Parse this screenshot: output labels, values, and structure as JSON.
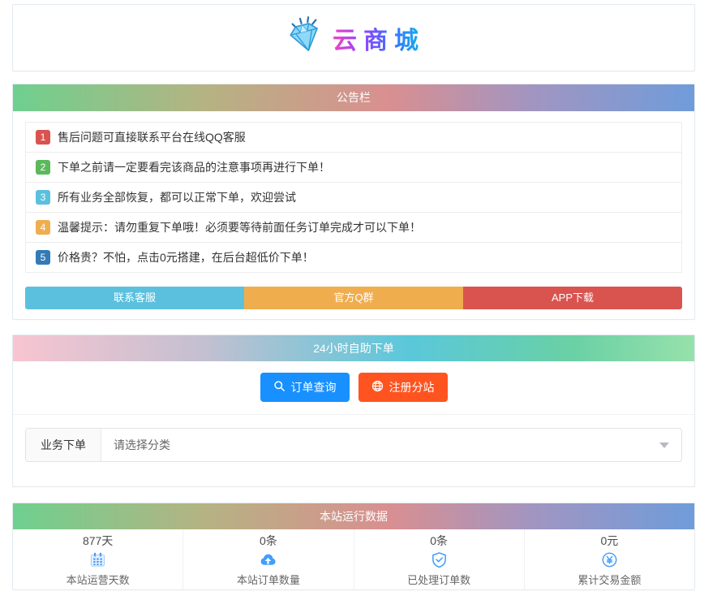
{
  "logo": {
    "title": "云商城",
    "title_gradient": "linear-gradient(90deg, #f542c8 0%, #8a46ff 35%, #2f7bff 70%, #14b8e6 100%)",
    "icon": "diamond-icon"
  },
  "announcement": {
    "header": "公告栏",
    "header_gradient": "linear-gradient(90deg, #6ed08e 0%, #b5b383 28%, #d98f90 55%, #a295c1 76%, #6f9cda 100%)",
    "items": [
      {
        "num": "1",
        "color": "#d9534f",
        "text": "售后问题可直接联系平台在线QQ客服"
      },
      {
        "num": "2",
        "color": "#5cb85c",
        "text": "下单之前请一定要看完该商品的注意事项再进行下单！"
      },
      {
        "num": "3",
        "color": "#5bc0de",
        "text": "所有业务全部恢复，都可以正常下单，欢迎尝试"
      },
      {
        "num": "4",
        "color": "#f0ad4e",
        "text": "温馨提示：请勿重复下单哦！必须要等待前面任务订单完成才可以下单！"
      },
      {
        "num": "5",
        "color": "#337ab7",
        "text": "价格贵？不怕，点击0元搭建，在后台超低价下单！"
      }
    ],
    "buttons": [
      {
        "label": "联系客服",
        "color": "#5bc0de"
      },
      {
        "label": "官方Q群",
        "color": "#f0ad4e"
      },
      {
        "label": "APP下载",
        "color": "#d9534f"
      }
    ]
  },
  "order": {
    "header": "24小时自助下单",
    "header_gradient": "linear-gradient(90deg, #f8c5d1 0%, #c3c0d1 28%, #5ac8da 58%, #6ad0a5 82%, #97e1ab 100%)",
    "query_button": {
      "label": "订单查询",
      "color": "#1890ff",
      "icon": "search-icon"
    },
    "register_button": {
      "label": "注册分站",
      "color": "#ff5420",
      "icon": "globe-icon"
    },
    "form_label": "业务下单",
    "category_placeholder": "请选择分类"
  },
  "stats": {
    "header": "本站运行数据",
    "header_gradient": "linear-gradient(90deg, #6ed08e 0%, #b5b383 28%, #d98f90 55%, #a295c1 76%, #6f9cda 100%)",
    "items": [
      {
        "value": "877天",
        "label": "本站运营天数",
        "icon": "calendar-icon"
      },
      {
        "value": "0条",
        "label": "本站订单数量",
        "icon": "cloud-upload-icon"
      },
      {
        "value": "0条",
        "label": "已处理订单数",
        "icon": "shield-check-icon"
      },
      {
        "value": "0元",
        "label": "累计交易金额",
        "icon": "yen-circle-icon"
      }
    ]
  },
  "colors": {
    "card_border": "#e3e9ef",
    "stat_icon_blue": "#409eff",
    "bootstrap_danger": "#d9534f",
    "bootstrap_success": "#5cb85c",
    "bootstrap_info": "#5bc0de",
    "bootstrap_warning": "#f0ad4e",
    "bootstrap_primary": "#337ab7"
  }
}
